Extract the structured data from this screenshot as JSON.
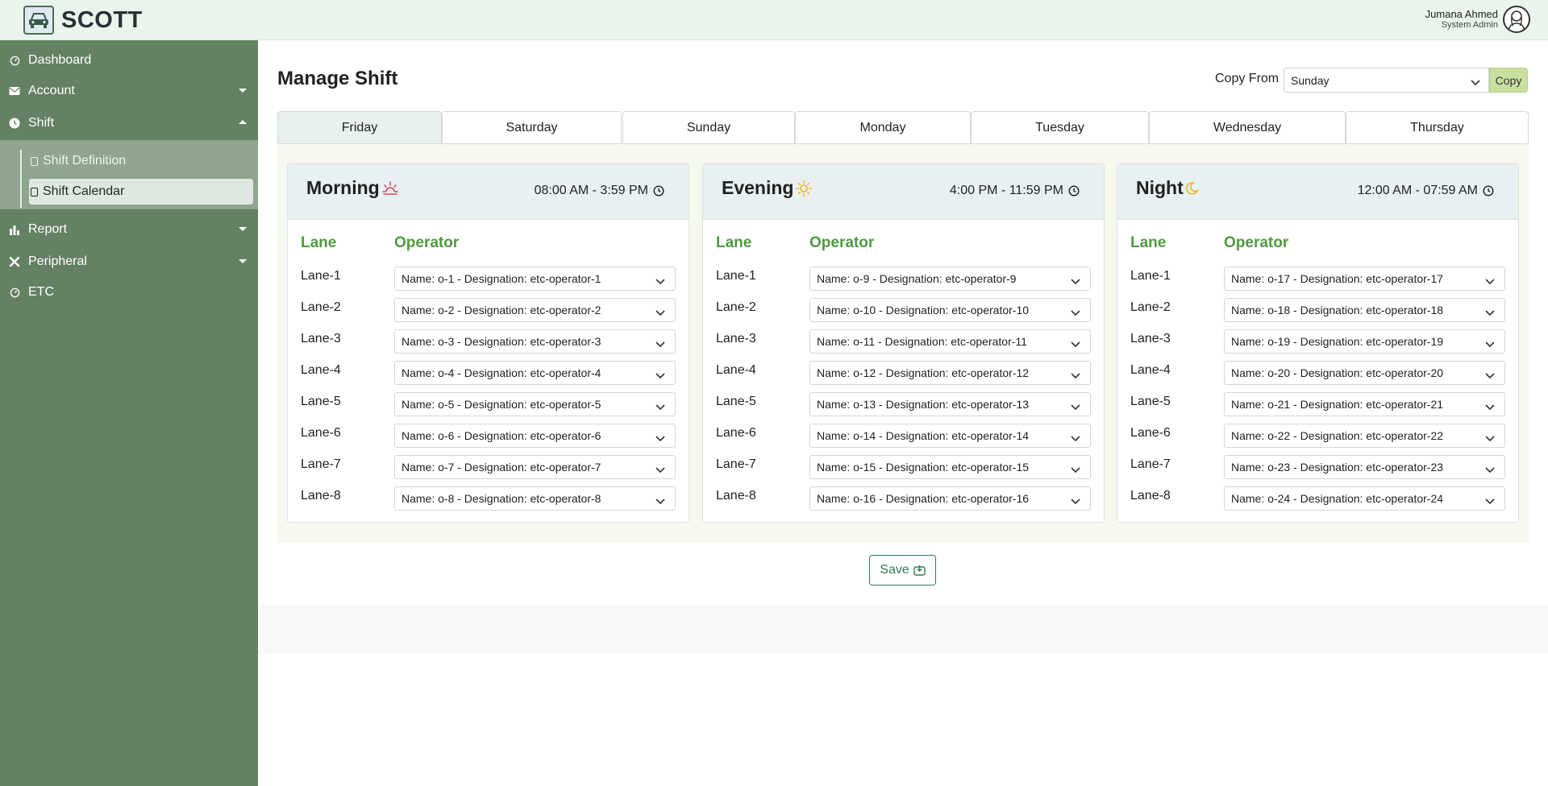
{
  "header": {
    "brand": "SCOTT",
    "user_name": "Jumana Ahmed",
    "user_role": "System Admin"
  },
  "sidebar": {
    "items": [
      {
        "label": "Dashboard",
        "icon": "dashboard-icon"
      },
      {
        "label": "Account",
        "icon": "envelope-icon"
      },
      {
        "label": "Shift",
        "icon": "clock-icon"
      },
      {
        "label": "Report",
        "icon": "bar-chart-icon"
      },
      {
        "label": "Peripheral",
        "icon": "tools-icon"
      },
      {
        "label": "ETC",
        "icon": "etc-icon"
      }
    ],
    "shift_submenu": [
      {
        "label": "Shift Definition"
      },
      {
        "label": "Shift Calendar",
        "active": true
      }
    ]
  },
  "main": {
    "title": "Manage Shift",
    "copy_from_label": "Copy From",
    "copy_from_value": "Sunday",
    "copy_button": "Copy",
    "tabs": [
      "Friday",
      "Saturday",
      "Sunday",
      "Monday",
      "Tuesday",
      "Wednesday",
      "Thursday"
    ],
    "active_tab": "Friday",
    "lane_header": "Lane",
    "operator_header": "Operator",
    "save_label": "Save",
    "shifts": [
      {
        "name": "Morning",
        "time": "08:00 AM - 3:59 PM",
        "icon": "sunrise-icon",
        "icon_color": "#e0415a",
        "lanes": [
          {
            "lane": "Lane-1",
            "operator": "Name: o-1 - Designation: etc-operator-1"
          },
          {
            "lane": "Lane-2",
            "operator": "Name: o-2 - Designation: etc-operator-2"
          },
          {
            "lane": "Lane-3",
            "operator": "Name: o-3 - Designation: etc-operator-3"
          },
          {
            "lane": "Lane-4",
            "operator": "Name: o-4 - Designation: etc-operator-4"
          },
          {
            "lane": "Lane-5",
            "operator": "Name: o-5 - Designation: etc-operator-5"
          },
          {
            "lane": "Lane-6",
            "operator": "Name: o-6 - Designation: etc-operator-6"
          },
          {
            "lane": "Lane-7",
            "operator": "Name: o-7 - Designation: etc-operator-7"
          },
          {
            "lane": "Lane-8",
            "operator": "Name: o-8 - Designation: etc-operator-8"
          }
        ]
      },
      {
        "name": "Evening",
        "time": "4:00 PM - 11:59 PM",
        "icon": "sun-icon",
        "icon_color": "#f0b323",
        "lanes": [
          {
            "lane": "Lane-1",
            "operator": "Name: o-9 - Designation: etc-operator-9"
          },
          {
            "lane": "Lane-2",
            "operator": "Name: o-10 - Designation: etc-operator-10"
          },
          {
            "lane": "Lane-3",
            "operator": "Name: o-11 - Designation: etc-operator-11"
          },
          {
            "lane": "Lane-4",
            "operator": "Name: o-12 - Designation: etc-operator-12"
          },
          {
            "lane": "Lane-5",
            "operator": "Name: o-13 - Designation: etc-operator-13"
          },
          {
            "lane": "Lane-6",
            "operator": "Name: o-14 - Designation: etc-operator-14"
          },
          {
            "lane": "Lane-7",
            "operator": "Name: o-15 - Designation: etc-operator-15"
          },
          {
            "lane": "Lane-8",
            "operator": "Name: o-16 - Designation: etc-operator-16"
          }
        ]
      },
      {
        "name": "Night",
        "time": "12:00 AM - 07:59 AM",
        "icon": "moon-icon",
        "icon_color": "#f0b323",
        "lanes": [
          {
            "lane": "Lane-1",
            "operator": "Name: o-17 - Designation: etc-operator-17"
          },
          {
            "lane": "Lane-2",
            "operator": "Name: o-18 - Designation: etc-operator-18"
          },
          {
            "lane": "Lane-3",
            "operator": "Name: o-19 - Designation: etc-operator-19"
          },
          {
            "lane": "Lane-4",
            "operator": "Name: o-20 - Designation: etc-operator-20"
          },
          {
            "lane": "Lane-5",
            "operator": "Name: o-21 - Designation: etc-operator-21"
          },
          {
            "lane": "Lane-6",
            "operator": "Name: o-22 - Designation: etc-operator-22"
          },
          {
            "lane": "Lane-7",
            "operator": "Name: o-23 - Designation: etc-operator-23"
          },
          {
            "lane": "Lane-8",
            "operator": "Name: o-24 - Designation: etc-operator-24"
          }
        ]
      }
    ]
  },
  "colors": {
    "sidebar_bg": "#648163",
    "submenu_bg": "#8fa58e",
    "header_bg": "#eaf3ec",
    "accent_green": "#4e9b3f",
    "copy_button_bg": "#c9dfa0",
    "save_border": "#2f7d57"
  }
}
